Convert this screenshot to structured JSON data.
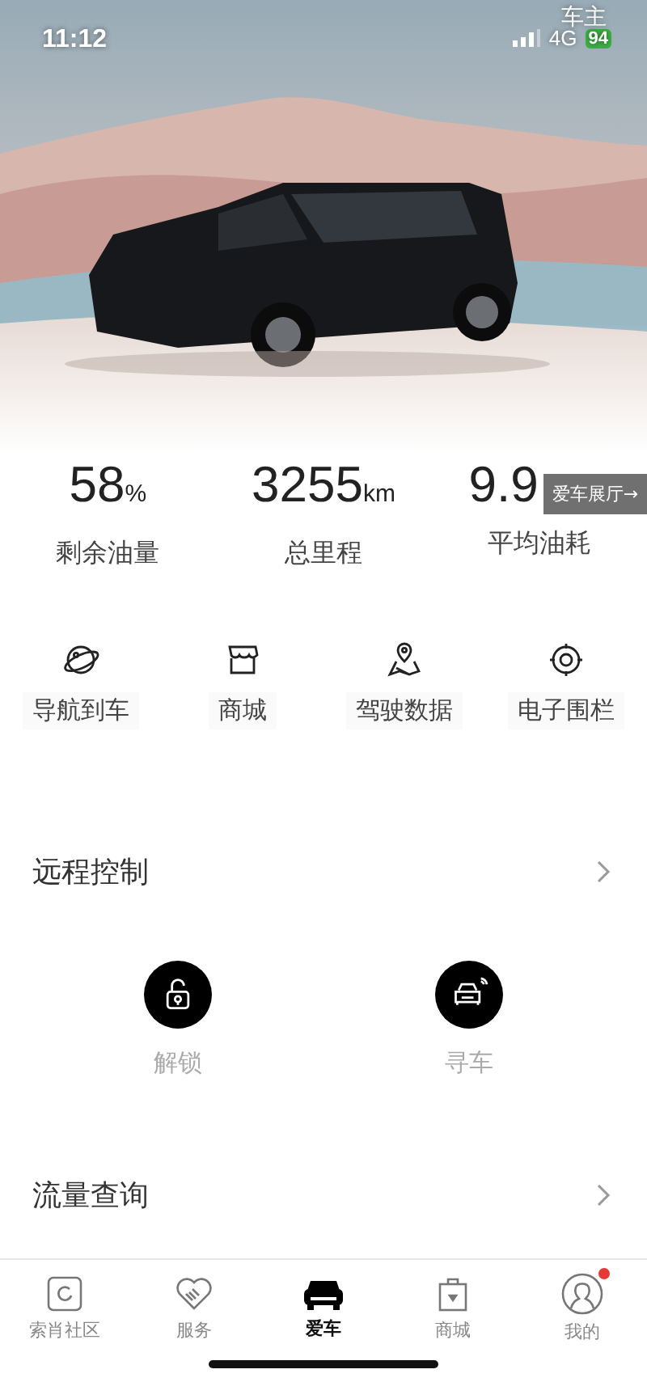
{
  "status_bar": {
    "time": "11:12",
    "network": "4G",
    "battery": "94",
    "corner_label": "车主"
  },
  "stats": [
    {
      "value": "58",
      "unit": "%",
      "label": "剩余油量"
    },
    {
      "value": "3255",
      "unit": "km",
      "label": "总里程"
    },
    {
      "value": "9.9",
      "label": "平均油耗"
    }
  ],
  "showroom_badge": "爱车展厅→",
  "quick_actions": [
    {
      "label": "导航到车"
    },
    {
      "label": "商城"
    },
    {
      "label": "驾驶数据"
    },
    {
      "label": "电子围栏"
    }
  ],
  "remote_control": {
    "title": "远程控制",
    "controls": [
      {
        "label": "解锁"
      },
      {
        "label": "寻车"
      }
    ]
  },
  "data_query": {
    "title": "流量查询"
  },
  "tabs": [
    {
      "label": "索肖社区",
      "selected": false,
      "dot": false
    },
    {
      "label": "服务",
      "selected": false,
      "dot": false
    },
    {
      "label": "爱车",
      "selected": true,
      "dot": false
    },
    {
      "label": "商城",
      "selected": false,
      "dot": false
    },
    {
      "label": "我的",
      "selected": false,
      "dot": true
    }
  ]
}
